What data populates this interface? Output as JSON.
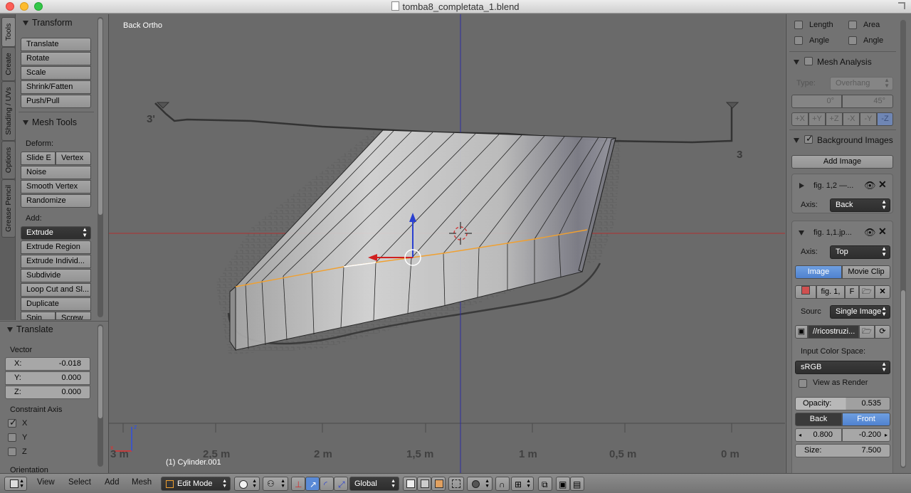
{
  "window": {
    "title": "tomba8_completata_1.blend"
  },
  "tool_tabs": [
    "Tools",
    "Create",
    "Shading / UVs",
    "Options",
    "Grease Pencil"
  ],
  "transform": {
    "title": "Transform",
    "buttons": [
      "Translate",
      "Rotate",
      "Scale",
      "Shrink/Fatten",
      "Push/Pull"
    ]
  },
  "mesh_tools": {
    "title": "Mesh Tools",
    "deform_label": "Deform:",
    "slide_e": "Slide E",
    "vertex": "Vertex",
    "noise": "Noise",
    "smooth_vertex": "Smooth Vertex",
    "randomize": "Randomize",
    "add_label": "Add:",
    "extrude": "Extrude",
    "extrude_region": "Extrude Region",
    "extrude_individual": "Extrude Individ...",
    "subdivide": "Subdivide",
    "loop_cut": "Loop Cut and Sl...",
    "duplicate": "Duplicate",
    "spin": "Spin",
    "screw": "Screw"
  },
  "operator": {
    "title": "Translate",
    "vector_label": "Vector",
    "x_label": "X:",
    "x_value": "-0.018",
    "y_label": "Y:",
    "y_value": "0.000",
    "z_label": "Z:",
    "z_value": "0.000",
    "constraint_label": "Constraint Axis",
    "cx": "X",
    "cy": "Y",
    "cz": "Z",
    "cx_checked": true,
    "cy_checked": false,
    "cz_checked": false,
    "orientation_label": "Orientation"
  },
  "viewport": {
    "view_label": "Back Ortho",
    "object_label": "(1) Cylinder.001",
    "ruler": [
      "3 m",
      "2,5 m",
      "2 m",
      "1,5 m",
      "1 m",
      "0,5 m",
      "0 m"
    ],
    "drawing_labels": [
      "3'",
      "3"
    ],
    "gizmo_z": "z",
    "gizmo_x": "x"
  },
  "properties": {
    "length": "Length",
    "area": "Area",
    "angle1": "Angle",
    "angle2": "Angle",
    "mesh_analysis": "Mesh Analysis",
    "type_label": "Type:",
    "type_value": "Overhang",
    "min_angle": "0°",
    "max_angle": "45°",
    "axes": [
      "+X",
      "+Y",
      "+Z",
      "-X",
      "-Y",
      "-Z"
    ],
    "bg_images": "Background Images",
    "add_image": "Add Image",
    "img1_name": "fig. 1,2 —...",
    "axis_label": "Axis:",
    "img1_axis": "Back",
    "img2_name": "fig. 1,1.jp...",
    "img2_axis": "Top",
    "image_tab": "Image",
    "movie_tab": "Movie Clip",
    "img_field": "fig. 1,",
    "f_label": "F",
    "source_label": "Sourc",
    "source_value": "Single Image",
    "path": "//ricostruzi...",
    "color_space_label": "Input Color Space:",
    "color_space": "sRGB",
    "view_as_render": "View as Render",
    "opacity_label": "Opacity:",
    "opacity_value": "0.535",
    "back": "Back",
    "front": "Front",
    "offset_x": "0.800",
    "offset_y": "-0.200",
    "size_label": "Size:",
    "size_value": "7.500"
  },
  "header": {
    "menus": [
      "View",
      "Select",
      "Add",
      "Mesh"
    ],
    "mode": "Edit Mode",
    "orientation": "Global"
  },
  "colors": {
    "accent_blue": "#5a8ad6",
    "viewport_bg": "#6a6a6a",
    "edge_select": "#f0a030"
  }
}
